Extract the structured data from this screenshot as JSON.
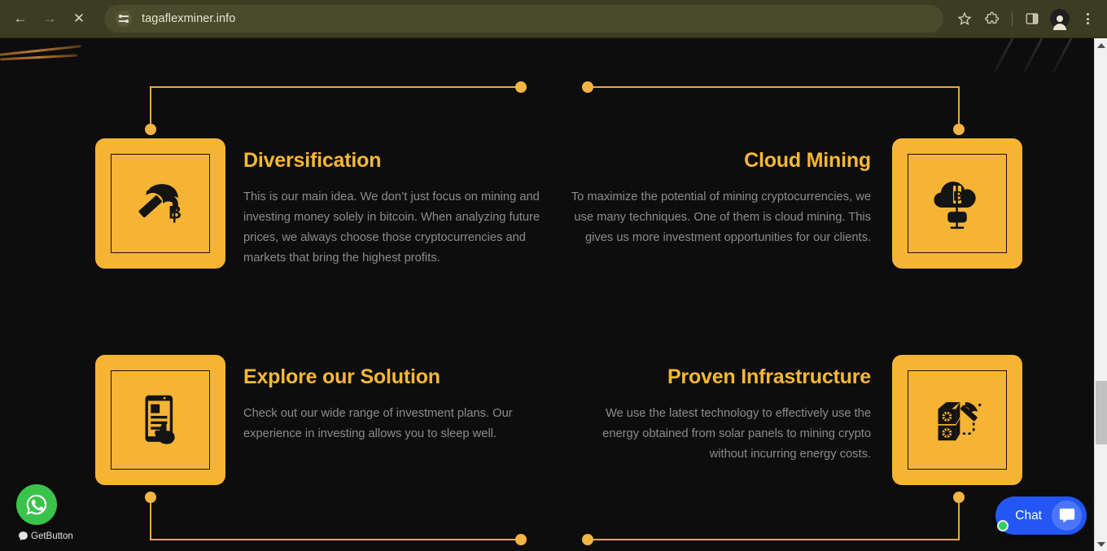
{
  "browser": {
    "back_label": "←",
    "forward_label": "→",
    "stop_label": "✕",
    "url": "tagaflexminer.info",
    "site_settings_icon": "tune-icon",
    "bookmark_icon": "star-icon",
    "extensions_icon": "puzzle-icon",
    "side_panel_icon": "side-panel-icon",
    "profile_icon": "avatar-icon",
    "menu_icon": "kebab-menu-icon"
  },
  "page": {
    "cards": [
      {
        "id": "diversification",
        "title": "Diversification",
        "body": "This is our main idea. We don’t just focus on mining and investing money solely in bitcoin. When analyzing future prices, we always choose those cryptocurrencies and markets that bring the highest profits.",
        "icon": "pickaxe-bitcoin-icon",
        "align": "left"
      },
      {
        "id": "cloud-mining",
        "title": "Cloud Mining",
        "body": "To maximize the potential of mining cryptocurrencies, we use many techniques. One of them is cloud mining. This gives us more investment opportunities for our clients.",
        "icon": "cloud-bitcoin-server-icon",
        "align": "right"
      },
      {
        "id": "explore-our-solution",
        "title": "Explore our Solution",
        "body": "Check out our wide range of investment plans. Our experience in investing allows you to sleep well.",
        "icon": "mobile-touch-icon",
        "align": "left"
      },
      {
        "id": "proven-infrastructure",
        "title": "Proven Infrastructure",
        "body": "We use the latest technology to effectively use the energy obtained from solar panels to mining crypto without incurring energy costs.",
        "icon": "server-pickaxe-icon",
        "align": "right"
      }
    ],
    "colors": {
      "accent": "#f5b433",
      "title": "#f5b836",
      "body_text": "#8c8c8c",
      "background": "#0d0d0d",
      "connector": "#e9a83a"
    }
  },
  "widgets": {
    "whatsapp": {
      "icon": "whatsapp-icon",
      "brand_label": "GetButton",
      "brand_icon": "getbutton-logo-icon"
    },
    "chat": {
      "label": "Chat",
      "icon": "chat-bubble-icon",
      "status": "online"
    }
  },
  "scrollbar": {
    "up_arrow": "scroll-up-arrow-icon",
    "down_arrow": "scroll-down-arrow-icon"
  }
}
